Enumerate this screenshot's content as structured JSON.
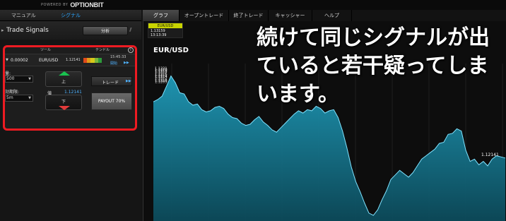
{
  "brand": {
    "small": "POWERED BY",
    "logo": "OPTIONBIT"
  },
  "left_menu": [
    "マニュアル",
    "シグナル",
    ""
  ],
  "tabs": [
    "グラフ",
    "オープントレード",
    "終了トレード",
    "キャッシャー",
    "ヘルプ"
  ],
  "signals_panel": {
    "title": "Trade Signals",
    "analysis_button": "分析",
    "column_headers": [
      "ツール",
      "テンドル"
    ],
    "info_icon": "i",
    "row": {
      "value": "0.00002",
      "pair": "EUR/USD",
      "price": "1.12141",
      "strength_colors": [
        "#e04a1a",
        "#e09a1a",
        "#d7c81a",
        "#7ab53a",
        "#2e9a3a"
      ],
      "time": "15:45:33",
      "open_label": "開始",
      "open_arrow": "▶▶"
    },
    "amount_label": "量:",
    "amount_value": "500",
    "expiry_label": "効期限:",
    "expiry_value": "5m",
    "up_label": "上",
    "price_label": "値",
    "price_value": "1.12141",
    "down_label": "下",
    "trade_button": "トレード",
    "trade_arrow": "▶▶",
    "payout": "PAYOUT 70%"
  },
  "mini_ticker": {
    "pair": "EUR/USD",
    "price": "1.13159",
    "time": "13:13:39"
  },
  "chart_data": {
    "type": "area",
    "title": "EUR/USD",
    "ylim": [
      1.2085,
      1.2225
    ],
    "y_ticks": [
      "1.1221",
      "1.1220",
      "1.1219",
      "1.1218",
      "1.1217",
      "1.1216",
      "1.1215",
      "1.1214",
      "1.1213",
      "1.1212",
      "1.1211",
      "1.1210",
      "1.1209"
    ],
    "last_value_label": "1.12141",
    "series": [
      {
        "color": "#2aa3c8",
        "values": [
          1.2191,
          1.2193,
          1.2196,
          1.2205,
          1.2214,
          1.2208,
          1.2199,
          1.2198,
          1.2191,
          1.2188,
          1.2189,
          1.2184,
          1.2182,
          1.2183,
          1.2186,
          1.2187,
          1.2185,
          1.218,
          1.2177,
          1.2176,
          1.2172,
          1.217,
          1.2171,
          1.2175,
          1.2178,
          1.2173,
          1.217,
          1.2166,
          1.2164,
          1.2168,
          1.2172,
          1.2176,
          1.218,
          1.2183,
          1.2181,
          1.2184,
          1.2183,
          1.2187,
          1.2185,
          1.2181,
          1.2183,
          1.2184,
          1.2177,
          1.2165,
          1.215,
          1.2133,
          1.212,
          1.2111,
          1.2101,
          1.2092,
          1.209,
          1.2095,
          1.2104,
          1.2112,
          1.2122,
          1.2126,
          1.213,
          1.2127,
          1.2124,
          1.2128,
          1.2134,
          1.214,
          1.2143,
          1.2146,
          1.2149,
          1.2154,
          1.2155,
          1.2162,
          1.2163,
          1.2167,
          1.2165,
          1.2148,
          1.2138,
          1.214,
          1.2135,
          1.2138,
          1.2134,
          1.214,
          1.2143,
          1.2142,
          1.2141
        ]
      }
    ]
  },
  "overlay_text": "続けて同じシグナルが出ていると若干疑ってしまいます。"
}
